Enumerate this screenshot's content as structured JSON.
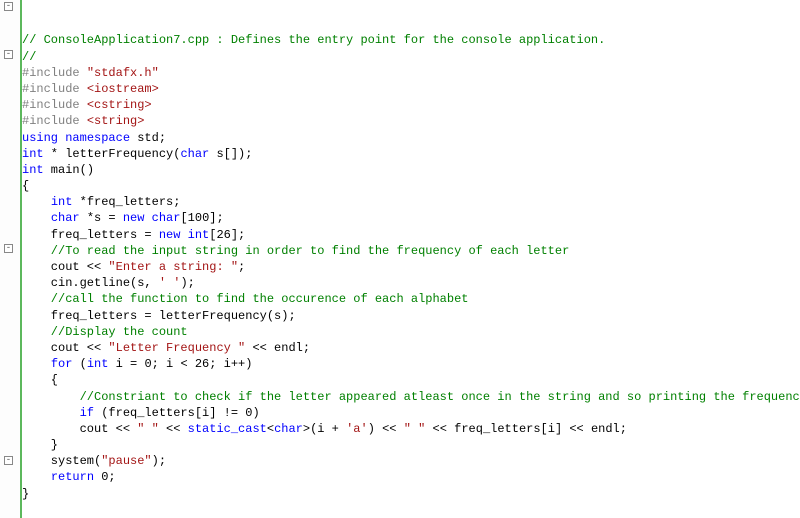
{
  "lines": {
    "l1": "// ConsoleApplication7.cpp : Defines the entry point for the console application.",
    "l2": "//",
    "l3": "",
    "l4_pp": "#include ",
    "l4_str": "\"stdafx.h\"",
    "l5": "",
    "l6": "",
    "l7_pp": "#include ",
    "l7_str": "<iostream>",
    "l8_pp": "#include ",
    "l8_str": "<cstring>",
    "l9_pp": "#include ",
    "l9_str": "<string>",
    "l10": "",
    "l11_kw1": "using",
    "l11_kw2": "namespace",
    "l11_rest": " std;",
    "l12": "",
    "l13": "",
    "l14_type1": "int",
    "l14_mid": " * letterFrequency(",
    "l14_type2": "char",
    "l14_end": " s[]);",
    "l15": "",
    "l16_type": "int",
    "l16_rest": " main()",
    "l17": "{",
    "l18_pre": "    ",
    "l18_type": "int",
    "l18_rest": " *freq_letters;",
    "l19_pre": "    ",
    "l19_type": "char",
    "l19_mid": " *s = ",
    "l19_kw": "new",
    "l19_mid2": " ",
    "l19_type2": "char",
    "l19_end": "[100];",
    "l20_pre": "    freq_letters = ",
    "l20_kw": "new",
    "l20_mid": " ",
    "l20_type": "int",
    "l20_end": "[26];",
    "l21": "    //To read the input string in order to find the frequency of each letter",
    "l22_pre": "    cout << ",
    "l22_str": "\"Enter a string: \"",
    "l22_end": ";",
    "l23_pre": "    cin.getline(s, ",
    "l23_str": "' '",
    "l23_end": ");",
    "l24": "    //call the function to find the occurence of each alphabet",
    "l25": "    freq_letters = letterFrequency(s);",
    "l26": "",
    "l27": "    //Display the count",
    "l28_pre": "    cout << ",
    "l28_str": "\"Letter Frequency \"",
    "l28_end": " << endl;",
    "l29_pre": "    ",
    "l29_kw": "for",
    "l29_mid": " (",
    "l29_type": "int",
    "l29_end": " i = 0; i < 26; i++)",
    "l30": "    {",
    "l31": "        //Constriant to check if the letter appeared atleast once in the string and so printing the frequency of its occurence",
    "l32_pre": "        ",
    "l32_kw": "if",
    "l32_end": " (freq_letters[i] != 0)",
    "l33_pre": "        cout << ",
    "l33_str1": "\" \"",
    "l33_mid1": " << ",
    "l33_kw": "static_cast",
    "l33_mid2": "<",
    "l33_type": "char",
    "l33_mid3": ">(i + ",
    "l33_str2": "'a'",
    "l33_mid4": ") << ",
    "l33_str3": "\" \"",
    "l33_end": " << freq_letters[i] << endl;",
    "l34": "    }",
    "l35_pre": "    system(",
    "l35_str": "\"pause\"",
    "l35_end": ");",
    "l36_pre": "    ",
    "l36_kw": "return",
    "l36_end": " 0;",
    "l37": "",
    "l38": "}"
  }
}
